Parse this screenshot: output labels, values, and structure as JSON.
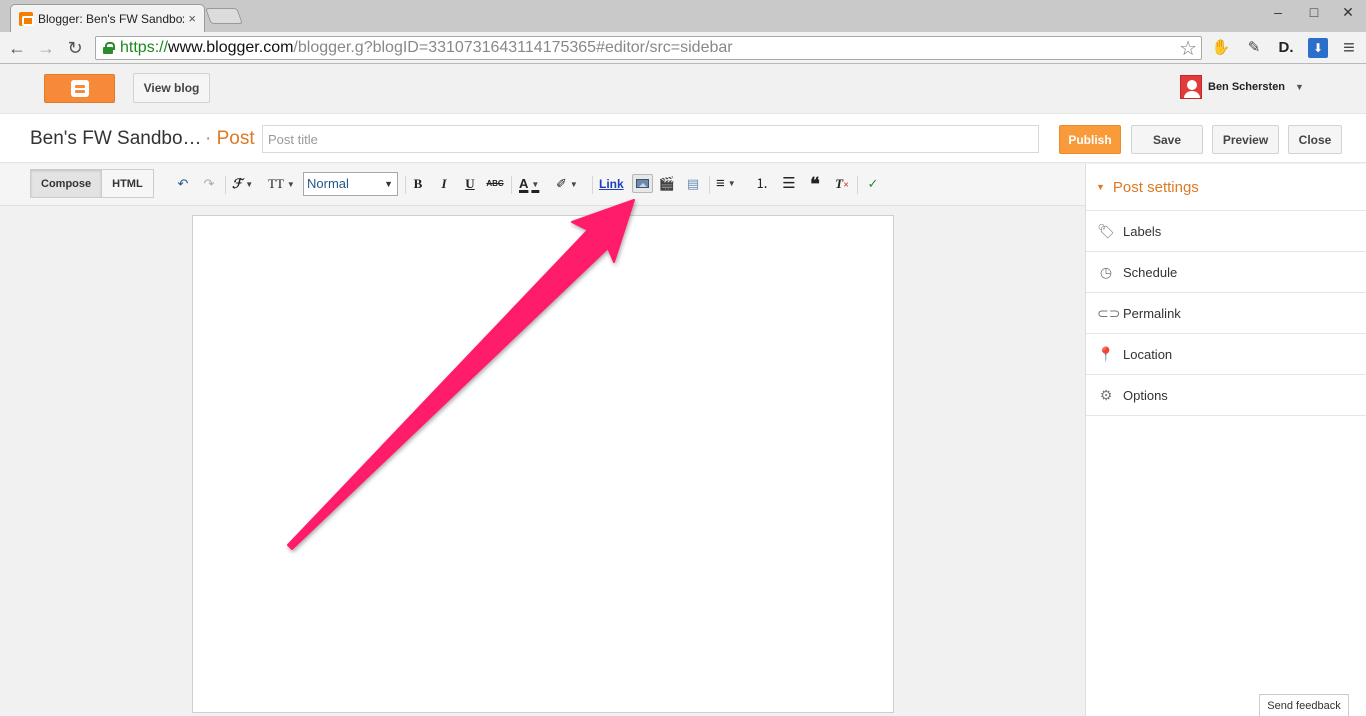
{
  "browser": {
    "tab_title": "Blogger: Ben's FW Sandbox",
    "tab_close": "×",
    "url_proto": "https://",
    "url_host": "www.blogger.com",
    "url_path": "/blogger.g?blogID=3310731643114175365#editor/src=sidebar",
    "controls": {
      "minimize": "–",
      "maximize": "□",
      "close": "✕"
    },
    "nav": {
      "back": "←",
      "forward": "→",
      "reload": "↻",
      "star": "☆",
      "menu": "≡"
    },
    "extensions": {
      "evernote": "✋",
      "tool": "✎",
      "d": "D.",
      "pocket": "⬇"
    }
  },
  "header": {
    "view_blog": "View blog",
    "user_name": "Ben Schersten"
  },
  "titlebar": {
    "blog_name": "Ben's FW Sandbo…",
    "post_label": "· Post",
    "post_title_placeholder": "Post title",
    "publish": "Publish",
    "save": "Save",
    "preview": "Preview",
    "close": "Close"
  },
  "editor": {
    "compose": "Compose",
    "html": "HTML",
    "format": "Normal",
    "link": "Link",
    "bold": "B",
    "italic": "I",
    "underline": "U",
    "strike": "ABC"
  },
  "sidebar": {
    "title": "Post settings",
    "items": [
      {
        "label": "Labels"
      },
      {
        "label": "Schedule"
      },
      {
        "label": "Permalink"
      },
      {
        "label": "Location"
      },
      {
        "label": "Options"
      }
    ]
  },
  "footer": {
    "feedback": "Send feedback"
  },
  "colors": {
    "accent": "#dd7a24",
    "publish": "#f99a3b",
    "arrow": "#ff1a6b"
  }
}
